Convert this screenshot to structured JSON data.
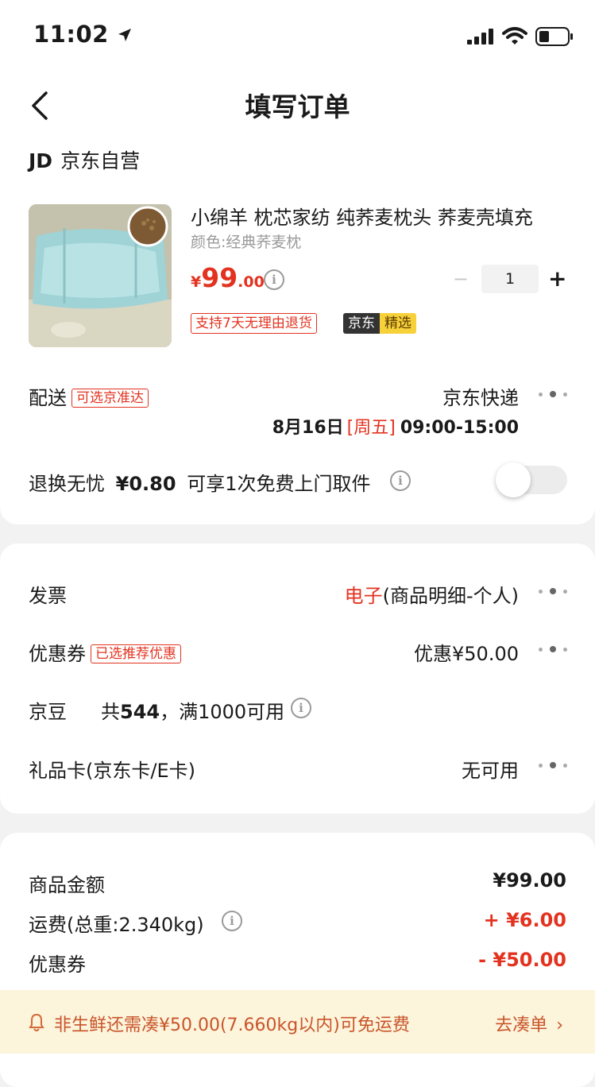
{
  "status_bar": {
    "time": "11:02"
  },
  "nav": {
    "title": "填写订单"
  },
  "shop": {
    "logo": "JD",
    "name": "京东自营"
  },
  "product": {
    "title": "小绵羊 枕芯家纺 纯荞麦枕头 荞麦壳填充",
    "variant": "颜色:经典荞麦枕",
    "price_symbol": "¥",
    "price_int": "99",
    "price_dec": ".00",
    "quantity": "1",
    "return_tag": "支持7天无理由退货",
    "jd_label": "京东",
    "pick_label": "精选"
  },
  "delivery": {
    "label": "配送",
    "tag": "可选京准达",
    "carrier": "京东快递",
    "date": "8月16日",
    "weekday": "[周五]",
    "time_window": "09:00-15:00"
  },
  "return_worry_free": {
    "label": "退换无忧",
    "price": "¥0.80",
    "desc": "可享1次免费上门取件",
    "enabled": false
  },
  "invoice": {
    "label": "发票",
    "type": "电子",
    "detail": "(商品明细-个人)"
  },
  "coupon": {
    "label": "优惠券",
    "tag": "已选推荐优惠",
    "value": "优惠¥50.00"
  },
  "jingdou": {
    "label": "京豆",
    "desc_prefix": "共",
    "count": "544",
    "desc_suffix": "，满1000可用"
  },
  "giftcard": {
    "label": "礼品卡(京东卡/E卡)",
    "value": "无可用"
  },
  "summary": {
    "goods_label": "商品金额",
    "goods_value": "¥99.00",
    "shipping_label": "运费(总重:2.340kg)",
    "shipping_value": "+ ¥6.00",
    "coupon_label": "优惠券",
    "coupon_value": "- ¥50.00"
  },
  "notice": {
    "text": "非生鲜还需凑¥50.00(7.660kg以内)可免运费",
    "action": "去凑单"
  },
  "colors": {
    "accent": "#e33320",
    "background": "#f2f2f2",
    "notice_bg": "#fdf4dc"
  }
}
